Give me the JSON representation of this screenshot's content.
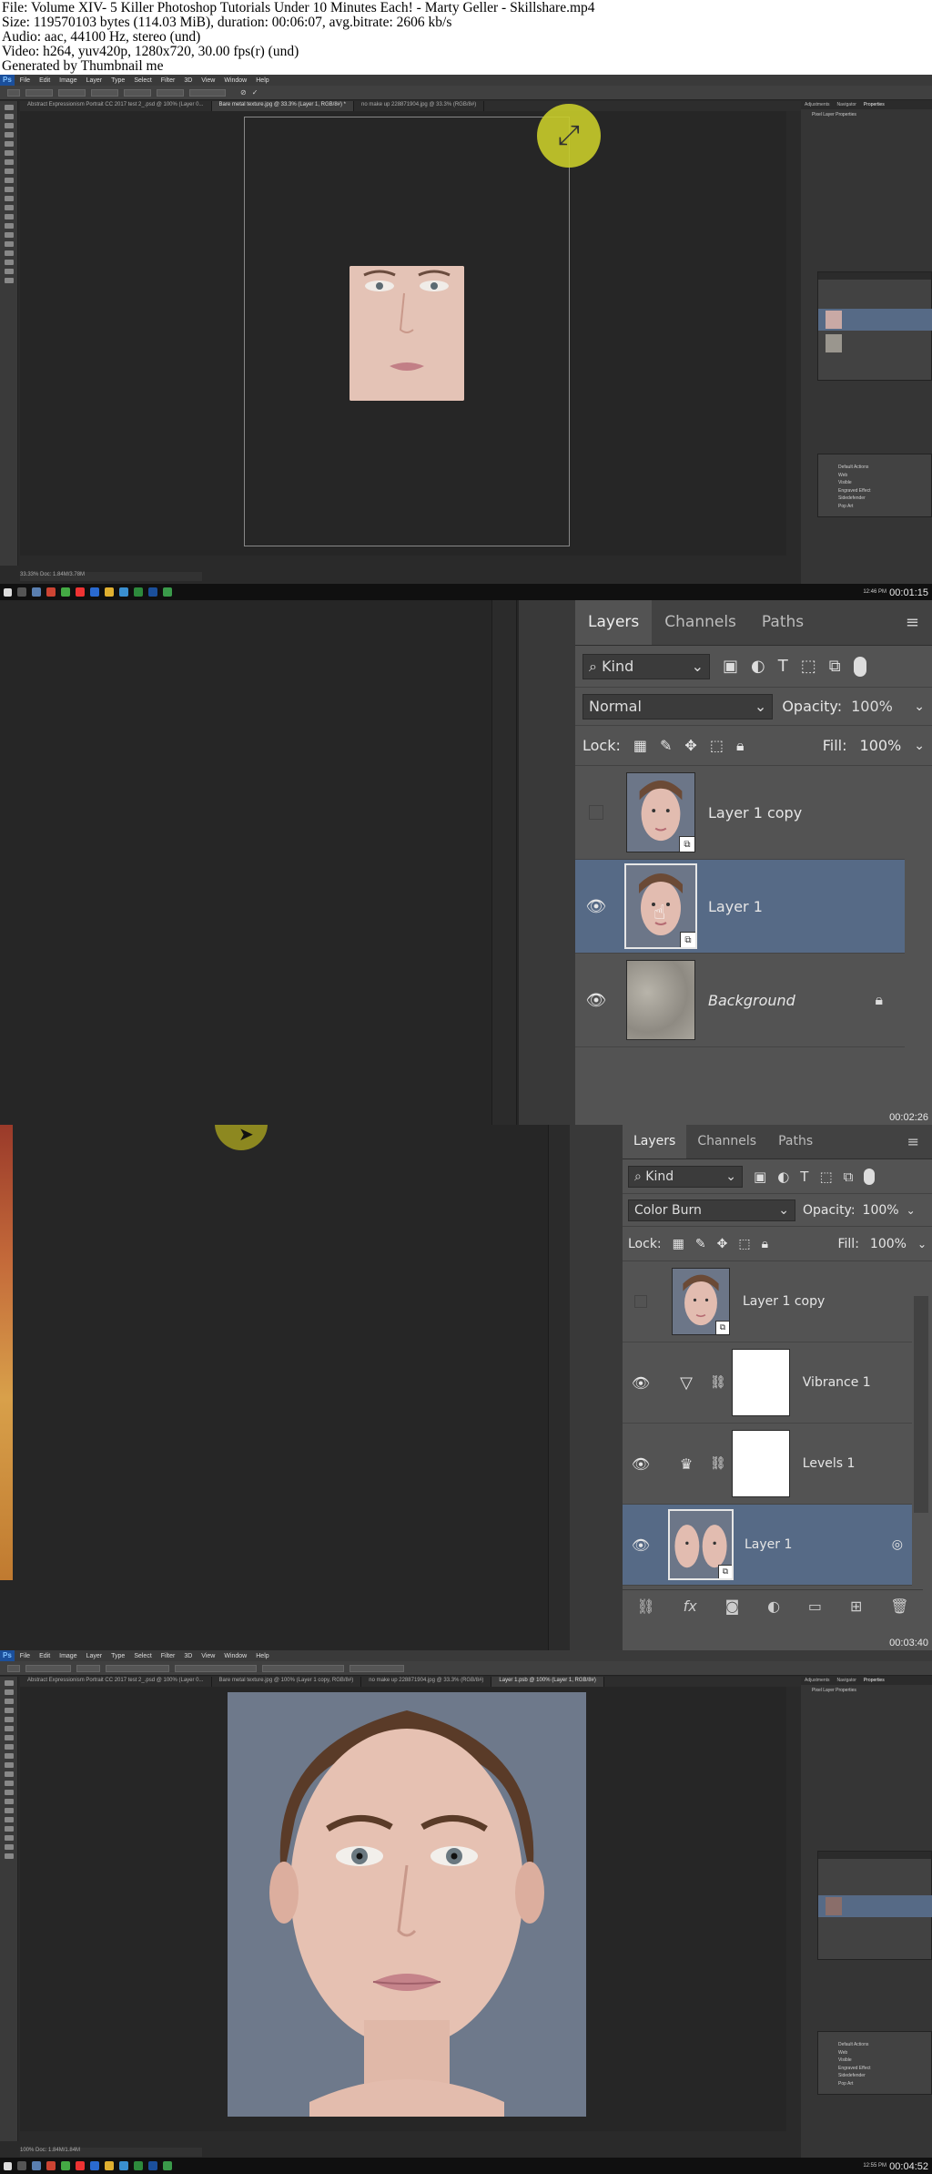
{
  "header": {
    "file": "File: Volume XIV- 5 Killer Photoshop Tutorials Under 10 Minutes Each! - Marty Geller - Skillshare.mp4",
    "size": "Size: 119570103 bytes (114.03 MiB), duration: 00:06:07, avg.bitrate: 2606 kb/s",
    "audio": "Audio: aac, 44100 Hz, stereo (und)",
    "video": "Video: h264, yuv420p, 1280x720, 30.00 fps(r) (und)",
    "generated": "Generated by Thumbnail me"
  },
  "frames": [
    {
      "timestamp": "00:01:15"
    },
    {
      "timestamp": "00:02:26"
    },
    {
      "timestamp": "00:03:40"
    },
    {
      "timestamp": "00:04:52"
    }
  ],
  "photoshop": {
    "menu": [
      "File",
      "Edit",
      "Image",
      "Layer",
      "Type",
      "Select",
      "Filter",
      "3D",
      "View",
      "Window",
      "Help"
    ],
    "frame1_tabs": [
      "Abstract Expressionism Portrait CC 2017 test 2_.psd @ 100% (Layer 0...",
      "Bare metal texture.jpg @ 33.3% (Layer 1, RGB/8#) *",
      "no make up 228871904.jpg @ 33.3% (RGB/8#)"
    ],
    "frame4_tabs": [
      "Abstract Expressionism Portrait CC 2017 test 2_.psd @ 100% (Layer 0...",
      "Bare metal texture.jpg @ 100% (Layer 1 copy, RGB/8#)",
      "no make up 228871904.jpg @ 33.3% (RGB/8#)",
      "Layer 1.psb @ 100% (Layer 1, RGB/8#)"
    ],
    "status1": "33.33%   Doc: 1.84M/3.78M",
    "status4": "100%   Doc: 1.84M/1.84M",
    "tray_time1": "12:46 PM",
    "tray_time4": "12:55 PM",
    "panel_titles": [
      "Adjustments",
      "Navigator",
      "Properties"
    ],
    "properties_title": "Pixel Layer Properties",
    "actions": [
      "Default Actions",
      "Web",
      "Visible",
      "Engraved Effect",
      "Sidedefender",
      "Pop Art"
    ],
    "history_tabs": [
      "History",
      "Actions"
    ]
  },
  "layers_panel_a": {
    "tabs": [
      "Layers",
      "Channels",
      "Paths"
    ],
    "filter_label": "Kind",
    "blend_mode": "Normal",
    "opacity_label": "Opacity:",
    "opacity_value": "100%",
    "lock_label": "Lock:",
    "fill_label": "Fill:",
    "fill_value": "100%",
    "layers": [
      {
        "name": "Layer 1 copy",
        "visible": false,
        "selected": false
      },
      {
        "name": "Layer 1",
        "visible": true,
        "selected": true
      },
      {
        "name": "Background",
        "visible": true,
        "selected": false,
        "locked": true
      }
    ]
  },
  "layers_panel_b": {
    "tabs": [
      "Layers",
      "Channels",
      "Paths"
    ],
    "filter_label": "Kind",
    "blend_mode": "Color Burn",
    "opacity_label": "Opacity:",
    "opacity_value": "100%",
    "lock_label": "Lock:",
    "fill_label": "Fill:",
    "fill_value": "100%",
    "layers": [
      {
        "name": "Layer 1 copy",
        "visible": false,
        "selected": false
      },
      {
        "name": "Vibrance 1",
        "visible": true,
        "selected": false
      },
      {
        "name": "Levels 1",
        "visible": true,
        "selected": false
      },
      {
        "name": "Layer 1",
        "visible": true,
        "selected": true
      }
    ]
  },
  "colors": {
    "ps_dark": "#262626",
    "panel": "#535353",
    "selected_layer": "#566a86",
    "cursor_highlight": "#c8cc2a"
  }
}
